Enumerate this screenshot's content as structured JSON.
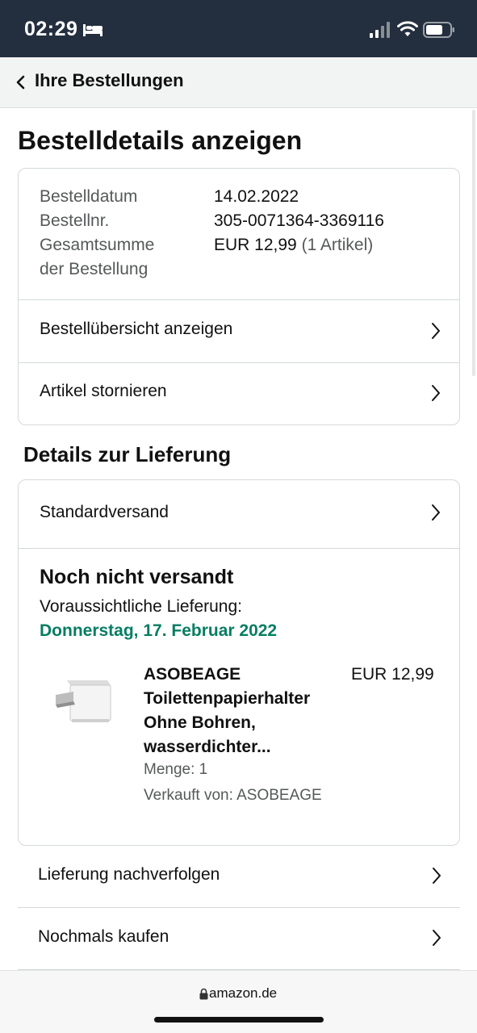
{
  "status_bar": {
    "time": "02:29",
    "icons": [
      "bed-icon",
      "signal-icon",
      "wifi-icon",
      "battery-icon"
    ]
  },
  "nav": {
    "back_label": "Ihre Bestellungen"
  },
  "page": {
    "title": "Bestelldetails anzeigen"
  },
  "order_summary": {
    "date_label": "Bestelldatum",
    "date_value": "14.02.2022",
    "number_label": "Bestellnr.",
    "number_value": "305-0071364-3369116",
    "total_label_line1": "Gesamtsumme",
    "total_label_line2": "der Bestellung",
    "total_value": "EUR 12,99",
    "total_items": "(1 Artikel)",
    "view_summary_label": "Bestellübersicht anzeigen",
    "cancel_label": "Artikel stornieren"
  },
  "delivery": {
    "section_title": "Details zur Lieferung",
    "shipping_method": "Standardversand",
    "status": "Noch nicht versandt",
    "expected_label": "Voraussichtliche Lieferung:",
    "expected_date": "Donnerstag, 17. Februar 2022",
    "accent_color": "#067d62"
  },
  "product": {
    "title": "ASOBEAGE Toilettenpapierhalter Ohne Bohren, wasserdichter...",
    "price": "EUR 12,99",
    "quantity": "Menge: 1",
    "seller": "Verkauft von: ASOBEAGE"
  },
  "actions": {
    "track_label": "Lieferung nachverfolgen",
    "buy_again_label": "Nochmals kaufen"
  },
  "browser": {
    "url": "amazon.de"
  },
  "colors": {
    "header_bg": "#232f3e",
    "nav_bg": "#f2f3f3",
    "border": "#d5d9d9",
    "secondary_text": "#565959"
  }
}
